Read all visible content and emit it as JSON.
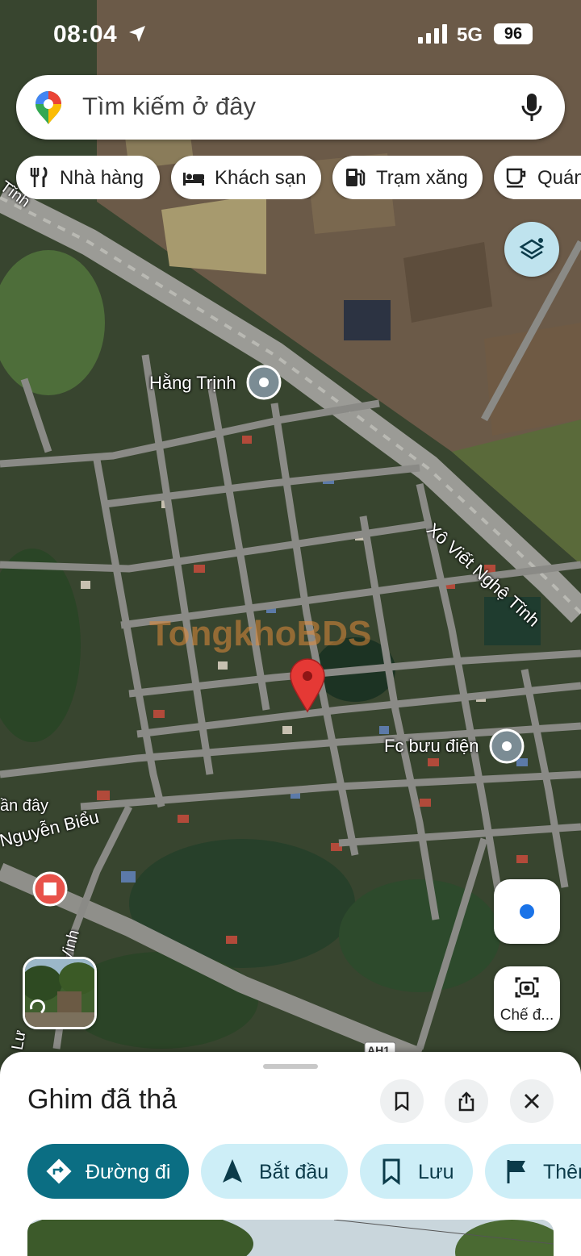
{
  "status_bar": {
    "time": "08:04",
    "network": "5G",
    "battery": "96"
  },
  "search": {
    "placeholder": "Tìm kiếm ở đây"
  },
  "chips": [
    {
      "label": "Nhà hàng",
      "icon": "restaurant-icon"
    },
    {
      "label": "Khách sạn",
      "icon": "hotel-icon"
    },
    {
      "label": "Trạm xăng",
      "icon": "gas-station-icon"
    },
    {
      "label": "Quán",
      "icon": "cafe-icon"
    }
  ],
  "map": {
    "labels": {
      "place_1": "Hằng Trịnh",
      "place_2": "Fc bưu điện",
      "road_1": "Xô Viết Nghệ Tĩnh",
      "road_2": "Nguyễn Biểu",
      "road_3": "Tĩnh",
      "road_4": "ần đây",
      "road_5": "Lư",
      "road_6": "Vinh",
      "highway": "AH1"
    },
    "watermark": "TongkhoBDS"
  },
  "map_buttons": {
    "lens_label": "Chế đ..."
  },
  "bottom_sheet": {
    "title": "Ghim đã thả",
    "actions": [
      {
        "label": "Đường đi",
        "icon": "directions-icon"
      },
      {
        "label": "Bắt đầu",
        "icon": "navigation-arrow-icon"
      },
      {
        "label": "Lưu",
        "icon": "bookmark-icon"
      },
      {
        "label": "Thêm",
        "icon": "flag-icon"
      }
    ]
  }
}
